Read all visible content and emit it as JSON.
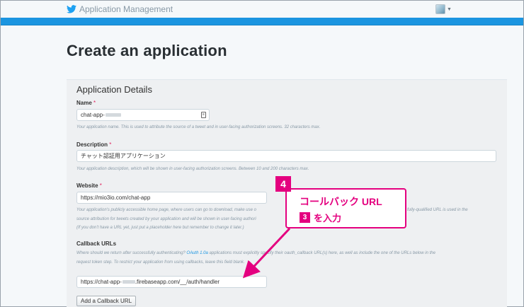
{
  "header": {
    "app_title": "Application Management",
    "brand_color": "#1b95e0"
  },
  "page": {
    "title": "Create an application"
  },
  "details": {
    "heading": "Application Details",
    "name": {
      "label": "Name",
      "required_mark": "*",
      "value": "chat-app-",
      "help": "Your application name. This is used to attribute the source of a tweet and in user-facing authorization screens. 32 characters max."
    },
    "description": {
      "label": "Description",
      "required_mark": "*",
      "value": "チャット認証用アプリケーション",
      "help": "Your application description, which will be shown in user-facing authorization screens. Between 10 and 200 characters max."
    },
    "website": {
      "label": "Website",
      "required_mark": "*",
      "value": "https://mio3io.com/chat-app",
      "help_line1_start": "Your application's publicly accessible home page, where users can go to download, make use o",
      "help_line1_end": "is fully-qualified URL is used in the",
      "help_line2": "source attribution for tweets created by your application and will be shown in user-facing authori",
      "help_line3": "(If you don't have a URL yet, just put a placeholder here but remember to change it later.)"
    },
    "callback": {
      "label": "Callback URLs",
      "help_line1_start": "Where should we return after successfully authenticating?",
      "help_link": "OAuth 1.0a",
      "help_line1_end": "applications must explicitly specify their oauth_callback URL(s) here, as well as include the one of the URLs below in the",
      "help_line2": "request token step. To restrict your application from using callbacks, leave this field blank.",
      "value_prefix": "https://chat-app-",
      "value_suffix": ".firebaseapp.com/__/auth/handler",
      "add_button": "Add a Callback URL"
    }
  },
  "annotation": {
    "step": "4",
    "line1": "コールバック URL",
    "ref_step": "3",
    "line2": "を入力",
    "color": "#e4007f"
  }
}
